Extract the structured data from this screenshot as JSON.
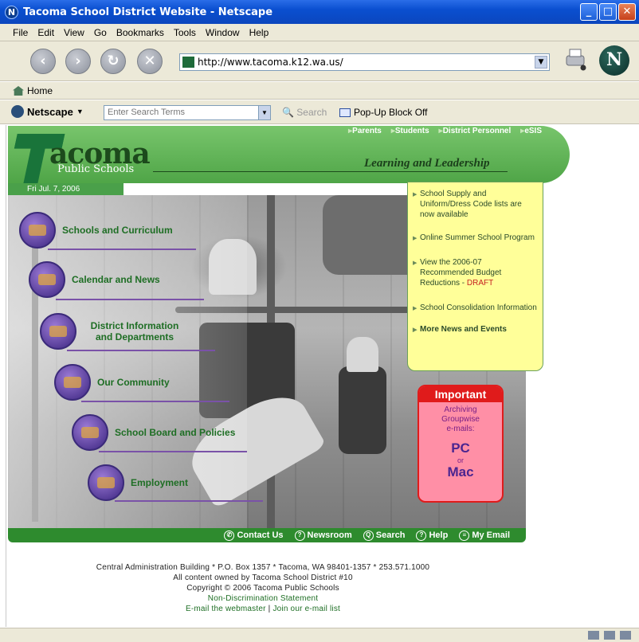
{
  "window": {
    "title": "Tacoma School District Website - Netscape"
  },
  "menu": [
    "File",
    "Edit",
    "View",
    "Go",
    "Bookmarks",
    "Tools",
    "Window",
    "Help"
  ],
  "nav": {
    "url": "http://www.tacoma.k12.wa.us/"
  },
  "bookmarks": {
    "home_label": "Home"
  },
  "searchbar": {
    "netscape_label": "Netscape",
    "placeholder": "Enter Search Terms",
    "search_label": "Search",
    "popup_label": "Pop-Up Block Off"
  },
  "site": {
    "top_links": [
      "Parents",
      "Students",
      "District Personnel",
      "eSIS"
    ],
    "logo_main": "acoma",
    "logo_sub": "Public Schools",
    "tagline": "Learning and Leadership",
    "date": "Fri Jul. 7, 2006",
    "nav_items": [
      {
        "label": "Schools and Curriculum"
      },
      {
        "label": "Calendar and News"
      },
      {
        "label": "District Information and Departments"
      },
      {
        "label": "Our Community"
      },
      {
        "label": "School Board and Policies"
      },
      {
        "label": "Employment"
      }
    ],
    "news": [
      {
        "text": "School Supply and Uniform/Dress Code lists are now available"
      },
      {
        "text": "Online Summer School Program"
      },
      {
        "text": "View the 2006-07 Recommended Budget Reductions - ",
        "draft": "DRAFT"
      },
      {
        "text": "School Consolidation Information"
      },
      {
        "text": "More News and Events"
      }
    ],
    "important": {
      "header": "Important",
      "line1": "Archiving",
      "line2": "Groupwise",
      "line3": "e-mails:",
      "pc": "PC",
      "or": "or",
      "mac": "Mac"
    },
    "footer_links": [
      "Contact Us",
      "Newsroom",
      "Search",
      "Help",
      "My Email"
    ],
    "address": {
      "line1": "Central Administration Building * P.O. Box 1357 * Tacoma, WA 98401-1357 * 253.571.1000",
      "line2": "All content owned by Tacoma School District #10",
      "line3": "Copyright © 2006 Tacoma Public Schools",
      "line4": "Non-Discrimination Statement",
      "line5a": "E-mail the webmaster",
      "line5b": "Join our e-mail list"
    }
  }
}
